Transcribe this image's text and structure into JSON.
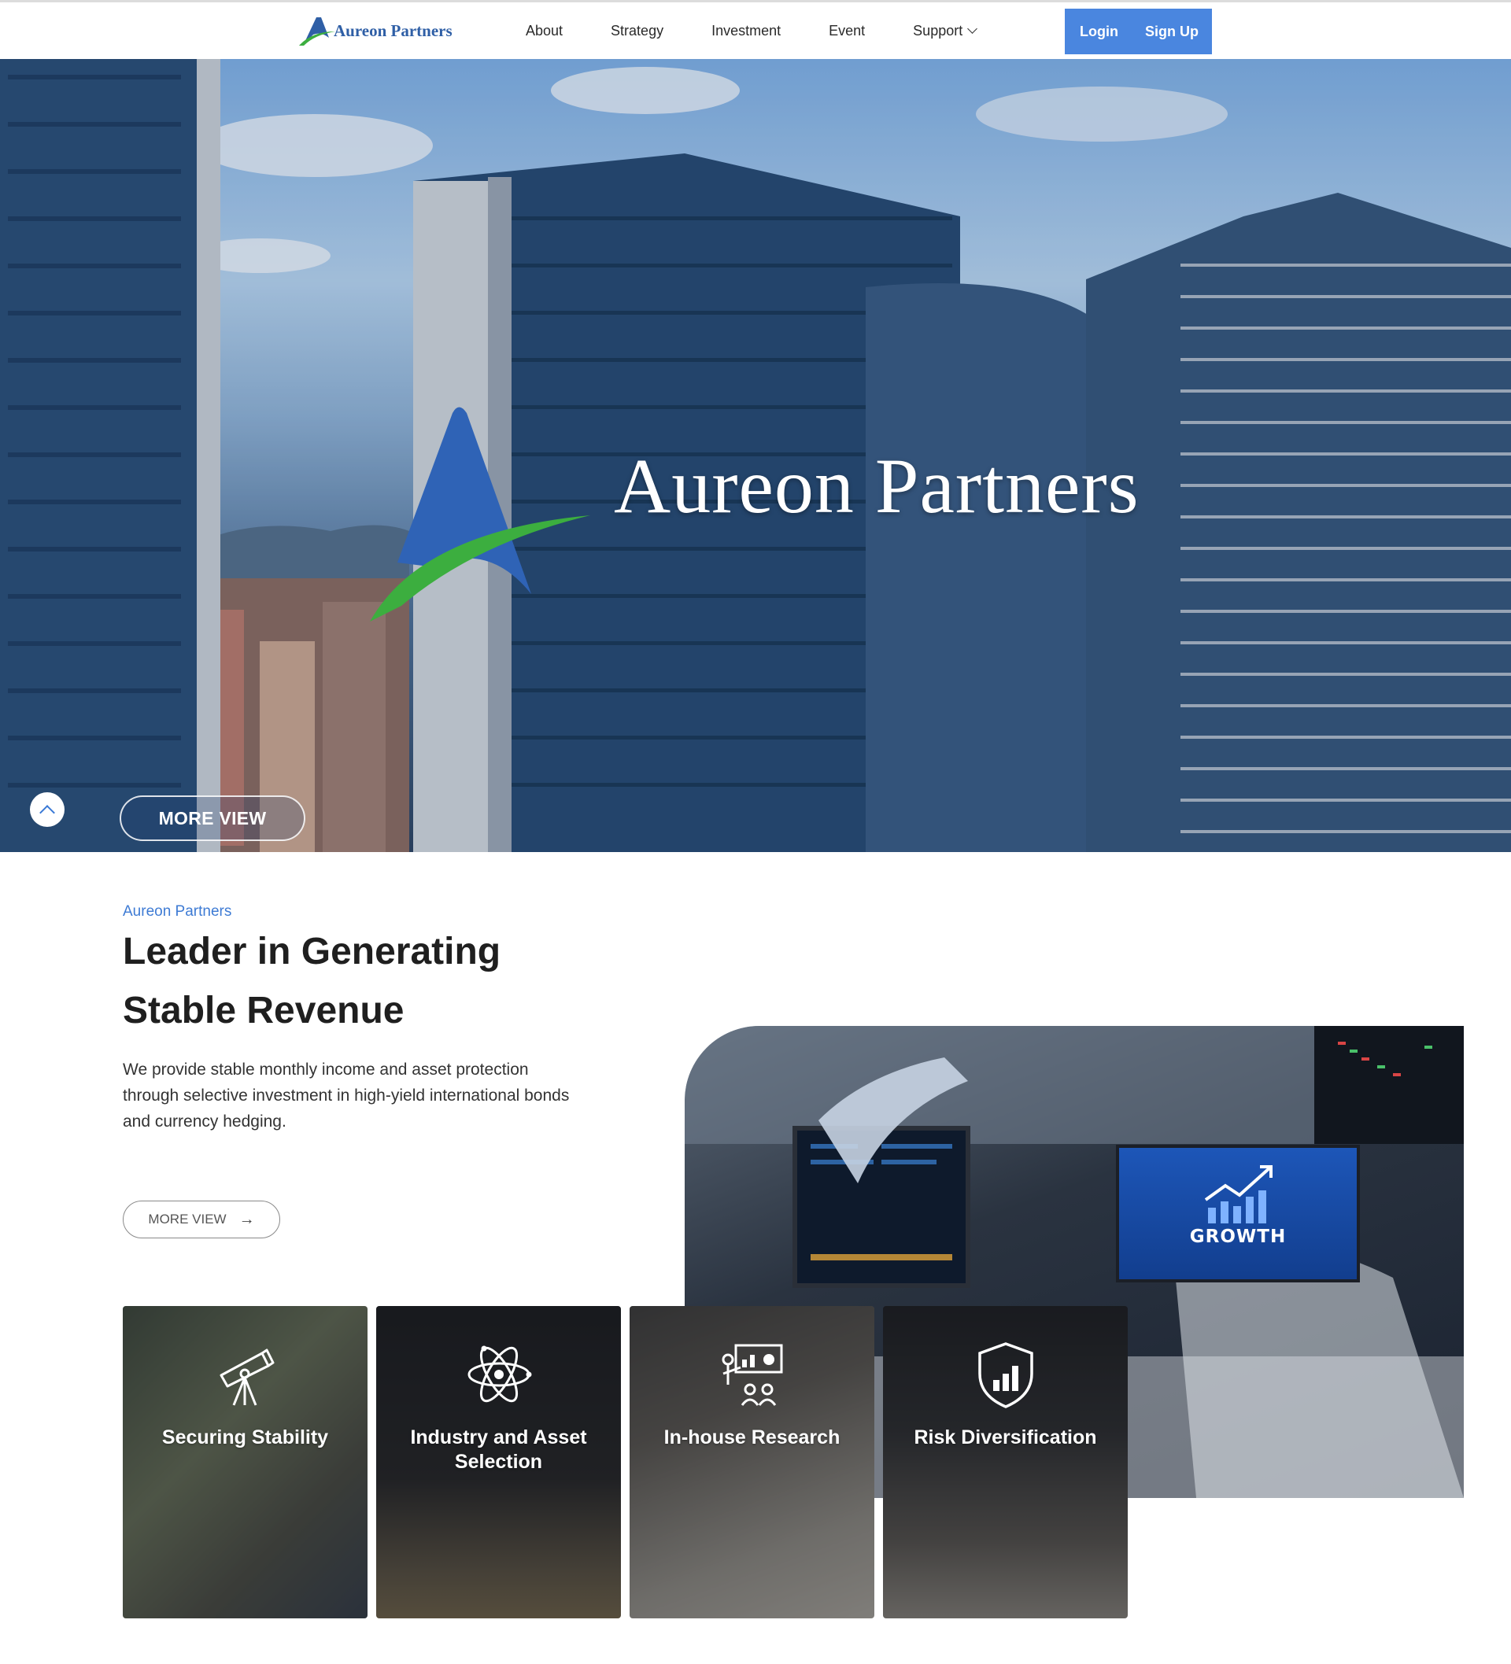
{
  "header": {
    "logo_text": "Aureon Partners",
    "nav": [
      {
        "label": "About"
      },
      {
        "label": "Strategy"
      },
      {
        "label": "Investment"
      },
      {
        "label": "Event"
      },
      {
        "label": "Support"
      }
    ],
    "login_label": "Login",
    "signup_label": "Sign Up"
  },
  "hero": {
    "title": "Aureon Partners",
    "more_label": "MORE VIEW"
  },
  "intro": {
    "eyebrow": "Aureon Partners",
    "headline_line1": "Leader in Generating",
    "headline_line2": "Stable Revenue",
    "description": "We provide stable monthly income and asset protection through selective investment in high-yield international bonds and currency hedging.",
    "more_label": "MORE VIEW",
    "photo_screen_text": "GROWTH"
  },
  "cards": [
    {
      "label": "Securing Stability",
      "icon": "telescope-icon"
    },
    {
      "label": "Industry and Asset Selection",
      "icon": "atom-icon"
    },
    {
      "label": "In-house Research",
      "icon": "presentation-icon"
    },
    {
      "label": "Risk Diversification",
      "icon": "shield-chart-icon"
    }
  ],
  "colors": {
    "accent": "#4a86df",
    "eyebrow": "#3e7bd4",
    "logo_blue": "#2f5fa6",
    "logo_green": "#3cae3f"
  }
}
